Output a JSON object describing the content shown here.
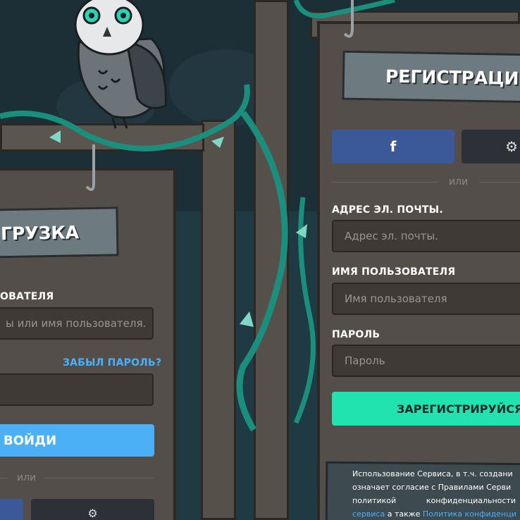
{
  "login": {
    "title": "ГРУЗКА",
    "username_label": "ОВАТЕЛЯ",
    "username_placeholder": "ы или имя пользователя.",
    "forgot_password": "ЗАБЫЛ ПАРОЛЬ?",
    "submit_label": "ВОЙДИ",
    "or_text": "или"
  },
  "register": {
    "title": "РЕГИСТРАЦИЯ",
    "or_text": "или",
    "facebook_glyph": "f",
    "email_label": "АДРЕС ЭЛ. ПОЧТЫ.",
    "email_placeholder": "Адрес эл. почты.",
    "username_label": "ИМЯ ПОЛЬЗОВАТЕЛЯ",
    "username_placeholder": "Имя пользователя",
    "password_label": "ПАРОЛЬ",
    "password_placeholder": "Пароль",
    "submit_label": "ЗАРЕГИСТРИРУЙСЯ",
    "legal_line1": "Использование Сервиса, в т.ч. создани",
    "legal_line2": "означает согласие с Правилами Серви",
    "legal_line3_a": "политикой",
    "legal_line3_b": "конфиденциальности",
    "legal_line4_link1": "сервиса",
    "legal_line4_text": " а также ",
    "legal_line4_link2": "Политика конфиденци"
  },
  "colors": {
    "login_button": "#4bb0f5",
    "register_button": "#21e3b0",
    "facebook": "#3b5998",
    "steam": "#2e3038",
    "accent_vine": "#1fae92"
  }
}
